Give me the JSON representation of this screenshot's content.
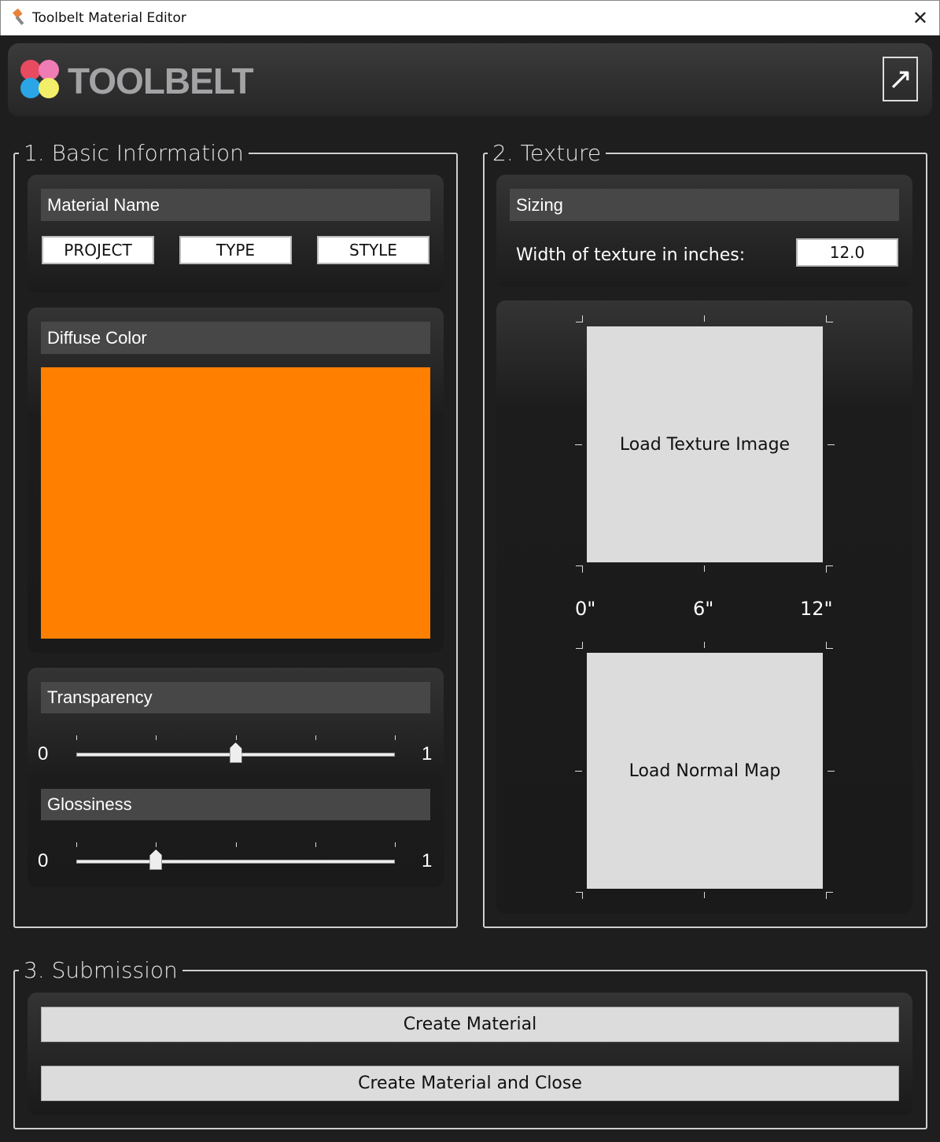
{
  "window": {
    "title": "Toolbelt Material Editor",
    "close": "✕"
  },
  "header": {
    "logo": "TOOLBELT",
    "export_icon": "↗"
  },
  "basic": {
    "legend": "1. Basic Information",
    "material_name": {
      "label": "Material Name",
      "buttons": [
        "PROJECT",
        "TYPE",
        "STYLE"
      ]
    },
    "diffuse": {
      "label": "Diffuse Color",
      "color": "#ff7f00"
    },
    "transparency": {
      "label": "Transparency",
      "min": "0",
      "max": "1",
      "value": 0.5
    },
    "glossiness": {
      "label": "Glossiness",
      "min": "0",
      "max": "1",
      "value": 0.25
    }
  },
  "texture": {
    "legend": "2. Texture",
    "sizing": {
      "label": "Sizing",
      "width_label": "Width of texture in inches:",
      "width_value": "12.0"
    },
    "load_texture": "Load Texture Image",
    "load_normal": "Load Normal Map",
    "scale": [
      "0\"",
      "6\"",
      "12\""
    ]
  },
  "submission": {
    "legend": "3. Submission",
    "create": "Create Material",
    "create_close": "Create Material and Close"
  }
}
